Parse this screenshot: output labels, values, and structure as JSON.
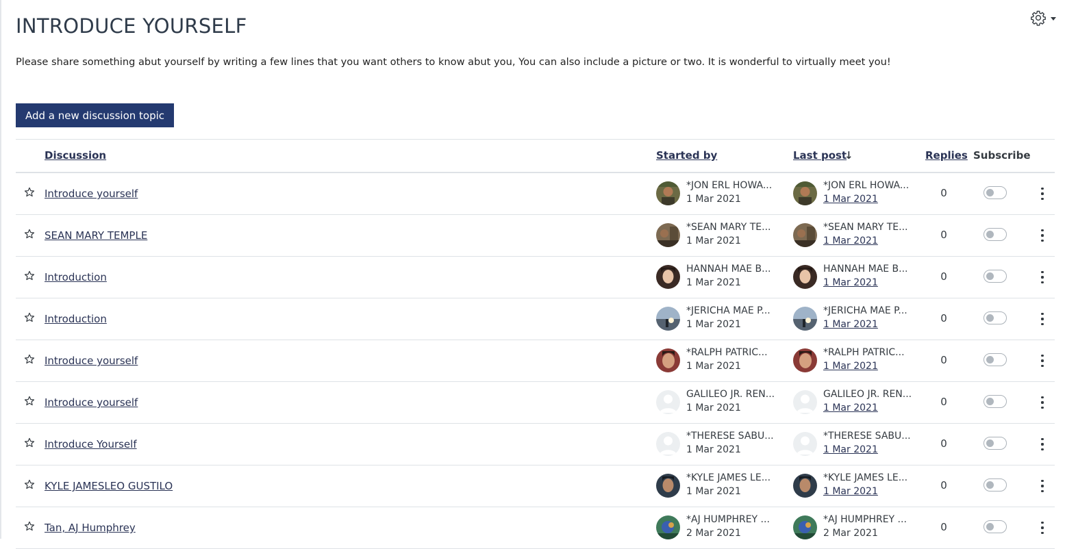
{
  "page": {
    "title": "INTRODUCE YOURSELF",
    "description": "Please share something abut yourself by writing a few lines that you want others to know abut you, You can also include a picture or two. It is wonderful to virtually meet you!",
    "settings_icon": "gear-icon",
    "add_button": "Add a new discussion topic"
  },
  "table": {
    "headers": {
      "discussion": "Discussion",
      "started_by": "Started by",
      "last_post": "Last post",
      "sort_indicator": "↓",
      "replies": "Replies",
      "subscribe": "Subscribe"
    },
    "rows": [
      {
        "title": "Introduce yourself",
        "starter": "*JON ERL HOWA...",
        "start_date": "1 Mar 2021",
        "last_poster": "*JON ERL HOWA...",
        "last_date": "1 Mar 2021",
        "replies": "0",
        "subscribed": false,
        "avatar": "photo-dark"
      },
      {
        "title": "SEAN MARY TEMPLE",
        "starter": "*SEAN MARY TE...",
        "start_date": "1 Mar 2021",
        "last_poster": "*SEAN MARY TE...",
        "last_date": "1 Mar 2021",
        "replies": "0",
        "subscribed": false,
        "avatar": "photo-outdoor"
      },
      {
        "title": "Introduction",
        "starter": "HANNAH MAE B...",
        "start_date": "1 Mar 2021",
        "last_poster": "HANNAH MAE B...",
        "last_date": "1 Mar 2021",
        "replies": "0",
        "subscribed": false,
        "avatar": "photo-portrait"
      },
      {
        "title": "Introduction",
        "starter": "*JERICHA MAE P...",
        "start_date": "1 Mar 2021",
        "last_poster": "*JERICHA MAE P...",
        "last_date": "1 Mar 2021",
        "replies": "0",
        "subscribed": false,
        "avatar": "photo-sky"
      },
      {
        "title": "Introduce yourself",
        "starter": "*RALPH PATRIC...",
        "start_date": "1 Mar 2021",
        "last_poster": "*RALPH PATRIC...",
        "last_date": "1 Mar 2021",
        "replies": "0",
        "subscribed": false,
        "avatar": "photo-face"
      },
      {
        "title": "Introduce yourself",
        "starter": "GALILEO JR. REN...",
        "start_date": "1 Mar 2021",
        "last_poster": "GALILEO JR. REN...",
        "last_date": "1 Mar 2021",
        "replies": "0",
        "subscribed": false,
        "avatar": "default-user"
      },
      {
        "title": "Introduce Yourself",
        "starter": "*THERESE SABU...",
        "start_date": "1 Mar 2021",
        "last_poster": "*THERESE SABU...",
        "last_date": "1 Mar 2021",
        "replies": "0",
        "subscribed": false,
        "avatar": "default-user"
      },
      {
        "title": "KYLE JAMESLEO GUSTILO",
        "starter": "*KYLE JAMES LE...",
        "start_date": "1 Mar 2021",
        "last_poster": "*KYLE JAMES LE...",
        "last_date": "1 Mar 2021",
        "replies": "0",
        "subscribed": false,
        "avatar": "photo-boy"
      },
      {
        "title": "Tan, AJ Humphrey",
        "starter": "*AJ HUMPHREY ...",
        "start_date": "2 Mar 2021",
        "last_poster": "*AJ HUMPHREY ...",
        "last_date": "2 Mar 2021",
        "replies": "0",
        "subscribed": false,
        "avatar": "photo-colorful"
      }
    ]
  }
}
